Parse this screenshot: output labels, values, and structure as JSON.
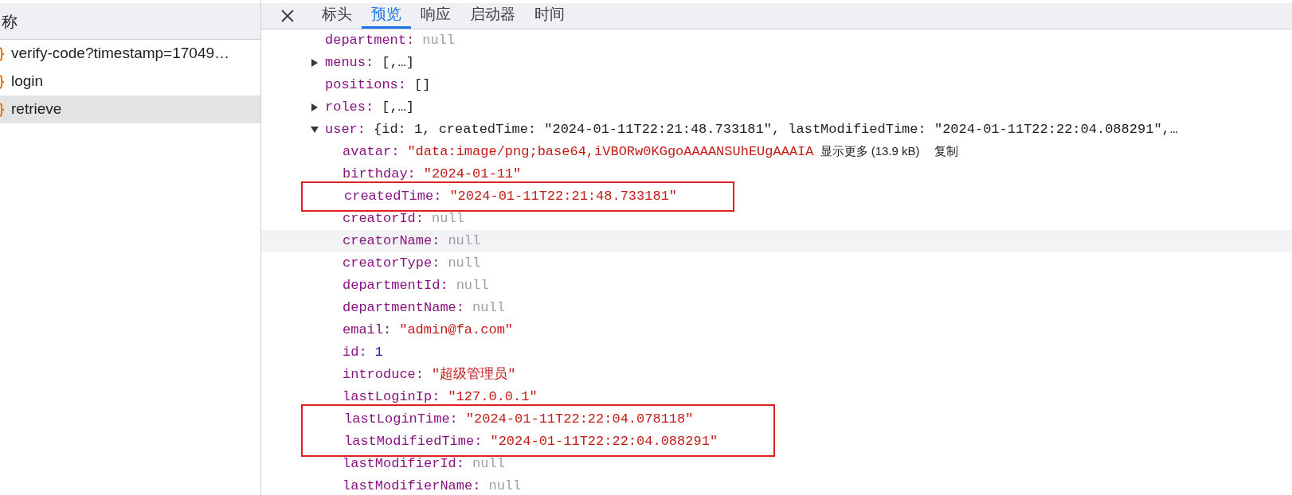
{
  "request_list": {
    "header": "称",
    "items": [
      {
        "name": "verify-code?timestamp=17049…",
        "selected": false
      },
      {
        "name": "login",
        "selected": false
      },
      {
        "name": "retrieve",
        "selected": true
      }
    ]
  },
  "detail": {
    "tabs": [
      {
        "label": "标头",
        "selected": false
      },
      {
        "label": "预览",
        "selected": true
      },
      {
        "label": "响应",
        "selected": false
      },
      {
        "label": "启动器",
        "selected": false
      },
      {
        "label": "时间",
        "selected": false
      }
    ],
    "preview": [
      {
        "key": "department:",
        "value": "null",
        "kind": "null"
      },
      {
        "key": "menus:",
        "value": "[,…]",
        "kind": "plain",
        "expanded": false
      },
      {
        "key": "positions:",
        "value": "[]",
        "kind": "plain"
      },
      {
        "key": "roles:",
        "value": "[,…]",
        "kind": "plain",
        "expanded": false
      },
      {
        "key": "user:",
        "value": "{id: 1, createdTime: \"2024-01-11T22:21:48.733181\", lastModifiedTime: \"2024-01-11T22:22:04.088291\",…",
        "kind": "plain",
        "expanded": true,
        "children": [
          {
            "key": "avatar:",
            "value": "\"data:image/png;base64,iVBORw0KGgoAAAANSUhEUgAAAIA",
            "kind": "string",
            "more": "显示更多 (13.9 kB)",
            "copy": "复制"
          },
          {
            "key": "birthday:",
            "value": "\"2024-01-11\"",
            "kind": "string"
          },
          {
            "kind": "frame",
            "children": [
              {
                "key": "createdTime:",
                "value": "\"2024-01-11T22:21:48.733181\"",
                "kind": "string"
              }
            ]
          },
          {
            "key": "creatorId:",
            "value": "null",
            "kind": "null"
          },
          {
            "key": "creatorName:",
            "value": "null",
            "kind": "null",
            "hovered": true
          },
          {
            "key": "creatorType:",
            "value": "null",
            "kind": "null"
          },
          {
            "key": "departmentId:",
            "value": "null",
            "kind": "null"
          },
          {
            "key": "departmentName:",
            "value": "null",
            "kind": "null"
          },
          {
            "key": "email:",
            "value": "\"admin@fa.com\"",
            "kind": "string"
          },
          {
            "key": "id:",
            "value": "1",
            "kind": "number"
          },
          {
            "key": "introduce:",
            "value": "\"超级管理员\"",
            "kind": "string"
          },
          {
            "key": "lastLoginIp:",
            "value": "\"127.0.0.1\"",
            "kind": "string"
          },
          {
            "kind": "frame",
            "children": [
              {
                "key": "lastLoginTime:",
                "value": "\"2024-01-11T22:22:04.078118\"",
                "kind": "string"
              },
              {
                "key": "lastModifiedTime:",
                "value": "\"2024-01-11T22:22:04.088291\"",
                "kind": "string"
              }
            ]
          },
          {
            "key": "lastModifierId:",
            "value": "null",
            "kind": "null"
          },
          {
            "key": "lastModifierName:",
            "value": "null",
            "kind": "null"
          }
        ]
      }
    ]
  }
}
